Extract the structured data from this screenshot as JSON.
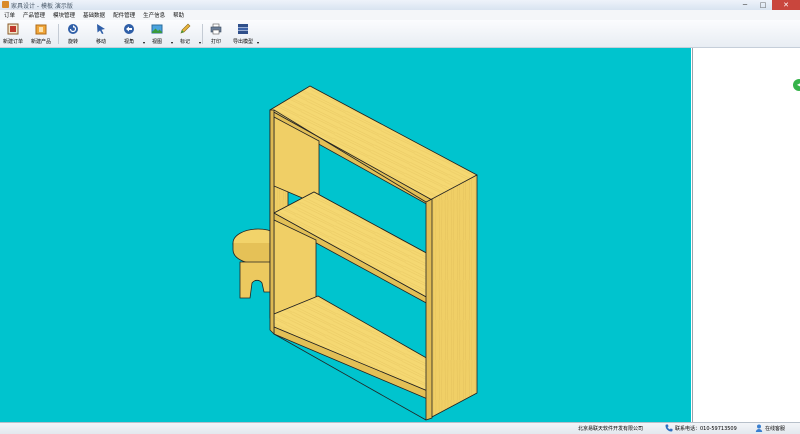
{
  "window": {
    "title": "家具设计 - 模板 演示版",
    "controls": {
      "minimize": "─",
      "maximize": "□",
      "close": "✕"
    }
  },
  "menu": [
    "订单",
    "产品管理",
    "模块管理",
    "基础数据",
    "配件管理",
    "生产信息",
    "帮助"
  ],
  "toolbar": {
    "new_order": "新建订单",
    "new_product": "新建产品",
    "rotate": "旋转",
    "move": "移动",
    "view": "视角",
    "image_view": "视图",
    "mark": "标记",
    "print": "打印",
    "export_model": "导出模型"
  },
  "status": {
    "company": "北京易联天软件开发有限公司",
    "phone": "联系电话：010-59713509",
    "online": "在线客服"
  },
  "colors": {
    "viewport_bg": "#00c4ce",
    "wood_face": "#f2d36a",
    "wood_side": "#e5c157",
    "wood_edge": "#caa53f",
    "online_green": "#36b34a"
  }
}
